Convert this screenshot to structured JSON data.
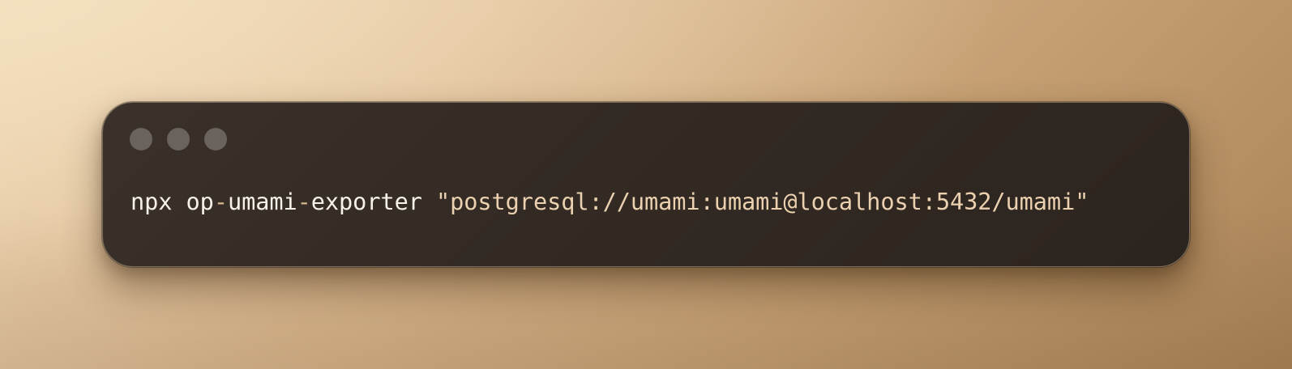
{
  "terminal": {
    "window_controls": [
      {
        "icon": "window-control-icon"
      },
      {
        "icon": "window-control-icon"
      },
      {
        "icon": "window-control-icon"
      }
    ],
    "command": {
      "segments": [
        {
          "text": "npx op",
          "role": "command"
        },
        {
          "text": "-",
          "role": "dash"
        },
        {
          "text": "umami",
          "role": "command"
        },
        {
          "text": "-",
          "role": "dash"
        },
        {
          "text": "exporter ",
          "role": "command"
        },
        {
          "text": "\"postgresql://umami:umami@localhost:5432/umami\"",
          "role": "string"
        }
      ]
    }
  },
  "colors": {
    "background_light": "#efd8b6",
    "background_dark": "#a98256",
    "terminal_background": "#322a23",
    "window_control": "#6a625c",
    "command_text": "#f7f1e8",
    "dash_text": "#d7b48b",
    "string_text": "#ecd1b0"
  }
}
